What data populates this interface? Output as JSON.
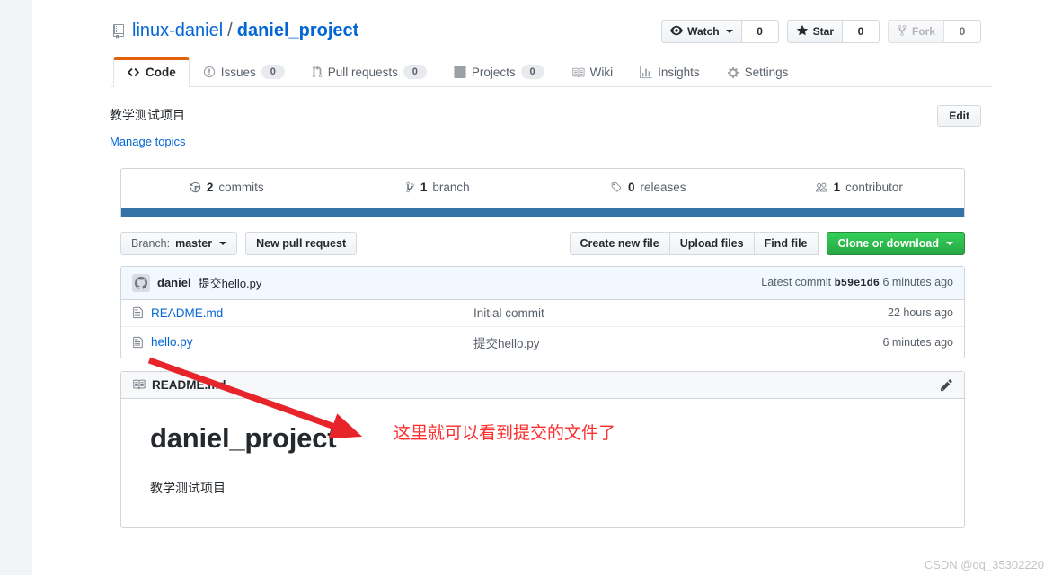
{
  "repo": {
    "owner": "linux-daniel",
    "separator": "/",
    "name": "daniel_project",
    "description": "教学测试项目",
    "manage_topics_label": "Manage topics",
    "edit_label": "Edit"
  },
  "actions": [
    {
      "label": "Watch",
      "count": "0",
      "icon": "eye-icon",
      "has_caret": true,
      "disabled": false
    },
    {
      "label": "Star",
      "count": "0",
      "icon": "star-icon",
      "has_caret": false,
      "disabled": false
    },
    {
      "label": "Fork",
      "count": "0",
      "icon": "fork-icon",
      "has_caret": false,
      "disabled": true
    }
  ],
  "nav": [
    {
      "label": "Code",
      "count": null,
      "icon": "code-icon",
      "selected": true
    },
    {
      "label": "Issues",
      "count": "0",
      "icon": "issue-opened-icon",
      "selected": false
    },
    {
      "label": "Pull requests",
      "count": "0",
      "icon": "git-pull-request-icon",
      "selected": false
    },
    {
      "label": "Projects",
      "count": "0",
      "icon": "project-icon",
      "selected": false
    },
    {
      "label": "Wiki",
      "count": null,
      "icon": "book-icon",
      "selected": false
    },
    {
      "label": "Insights",
      "count": null,
      "icon": "graph-icon",
      "selected": false
    },
    {
      "label": "Settings",
      "count": null,
      "icon": "gear-icon",
      "selected": false
    }
  ],
  "summary": [
    {
      "count": "2",
      "label": "commits",
      "icon": "history-icon"
    },
    {
      "count": "1",
      "label": "branch",
      "icon": "git-branch-icon"
    },
    {
      "count": "0",
      "label": "releases",
      "icon": "tag-icon"
    },
    {
      "count": "1",
      "label": "contributor",
      "icon": "people-icon"
    }
  ],
  "language_bar_color": "#3572A5",
  "file_nav": {
    "branch_prefix": "Branch:",
    "branch_name": "master",
    "new_pull_request": "New pull request",
    "create_new_file": "Create new file",
    "upload_files": "Upload files",
    "find_file": "Find file",
    "clone_or_download": "Clone or download"
  },
  "commit_tease": {
    "author": "daniel",
    "message": "提交hello.py",
    "latest_label": "Latest commit",
    "sha": "b59e1d6",
    "age": "6 minutes ago"
  },
  "files": [
    {
      "name": "README.md",
      "message": "Initial commit",
      "age": "22 hours ago",
      "icon": "file-icon"
    },
    {
      "name": "hello.py",
      "message": "提交hello.py",
      "age": "6 minutes ago",
      "icon": "file-icon"
    }
  ],
  "readme": {
    "title": "README.md",
    "heading": "daniel_project",
    "paragraph": "教学测试项目"
  },
  "annotation": {
    "text": "这里就可以看到提交的文件了",
    "color": "#ff2d2d"
  },
  "watermark": "CSDN @qq_35302220"
}
